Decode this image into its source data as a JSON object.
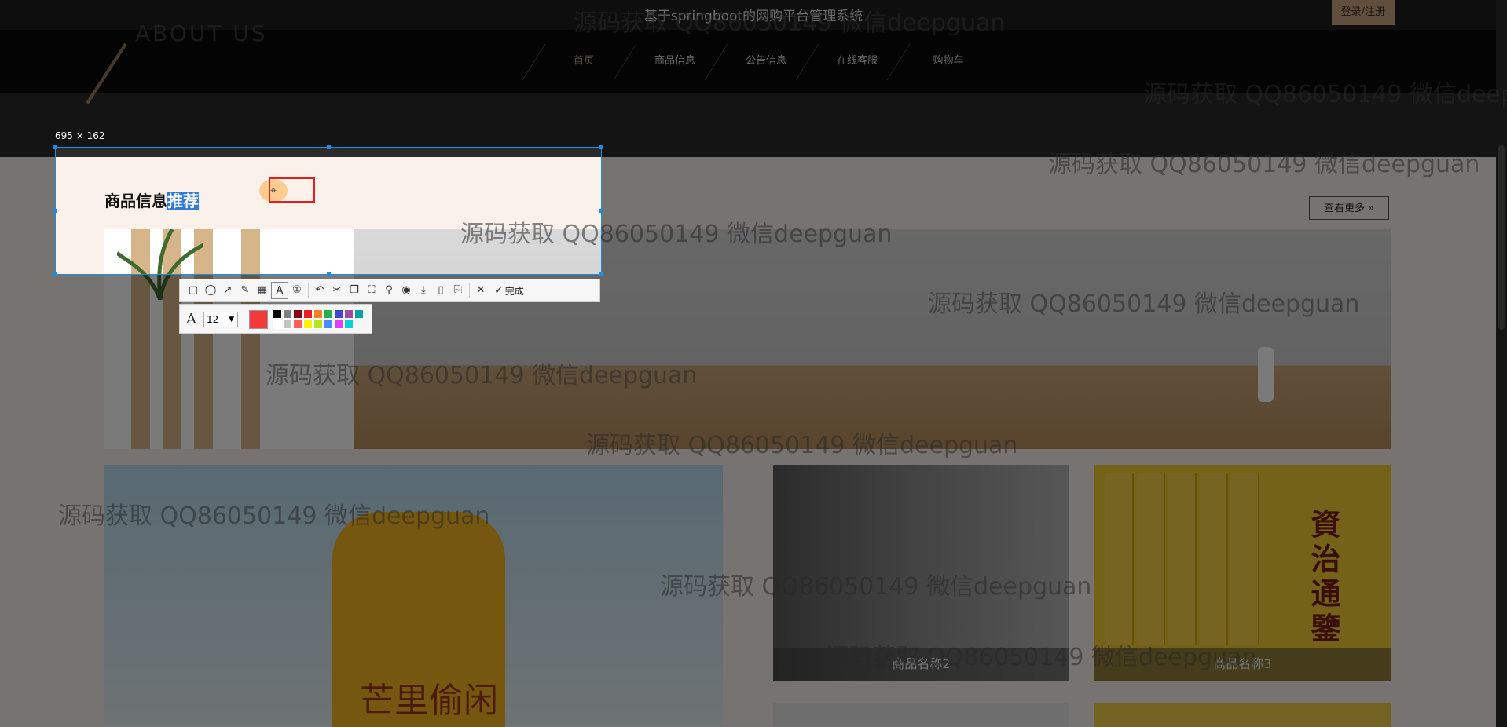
{
  "header": {
    "site_title": "基于springboot的网购平台管理系统",
    "login_label": "登录/注册"
  },
  "nav": {
    "items": [
      {
        "label": "首页"
      },
      {
        "label": "商品信息"
      },
      {
        "label": "公告信息"
      },
      {
        "label": "在线客服"
      },
      {
        "label": "购物车"
      }
    ]
  },
  "banner_text": "ABOUT US",
  "section": {
    "title_part1": "商品信息",
    "title_highlight": "推荐",
    "more_label": "查看更多 »"
  },
  "products": [
    {
      "name": "商品名称2"
    },
    {
      "name": "商品名称3"
    }
  ],
  "product_images": {
    "bottle_text": "芒里偷闲",
    "book_text": "資治通鑒"
  },
  "screenshot_tool": {
    "size_label": "695 × 162",
    "done_label": "完成",
    "font_size": "12",
    "current_color": "#f33a3a",
    "palette": [
      "#000000",
      "#7f7f7f",
      "#880015",
      "#ed1c24",
      "#ff7f27",
      "#22b14c",
      "#3f48cc",
      "#a349a4",
      "#00a2a2",
      "#ffffff",
      "#c3c3c3",
      "#ff5c5c",
      "#fff200",
      "#b5e61d",
      "#4a8cff",
      "#e040fb",
      "#00d4d4"
    ],
    "tools": [
      {
        "icon": "rectangle-icon",
        "glyph": "▢"
      },
      {
        "icon": "ellipse-icon",
        "glyph": "◯"
      },
      {
        "icon": "arrow-icon",
        "glyph": "↗"
      },
      {
        "icon": "pen-icon",
        "glyph": "✎"
      },
      {
        "icon": "mosaic-icon",
        "glyph": "▦"
      },
      {
        "icon": "text-icon",
        "glyph": "A"
      },
      {
        "icon": "number-marker-icon",
        "glyph": "①"
      },
      {
        "icon": "undo-icon",
        "glyph": "↶"
      },
      {
        "icon": "scissors-icon",
        "glyph": "✂"
      },
      {
        "icon": "copy-icon",
        "glyph": "❐"
      },
      {
        "icon": "fullscreen-icon",
        "glyph": "⛶"
      },
      {
        "icon": "pin-icon",
        "glyph": "⚲"
      },
      {
        "icon": "record-icon",
        "glyph": "◉"
      },
      {
        "icon": "download-icon",
        "glyph": "⤓"
      },
      {
        "icon": "long-screenshot-icon",
        "glyph": "▯"
      },
      {
        "icon": "bookmark-icon",
        "glyph": "⎘"
      },
      {
        "icon": "close-icon",
        "glyph": "✕"
      }
    ]
  },
  "watermark": "源码获取 QQ86050149 微信deepguan"
}
